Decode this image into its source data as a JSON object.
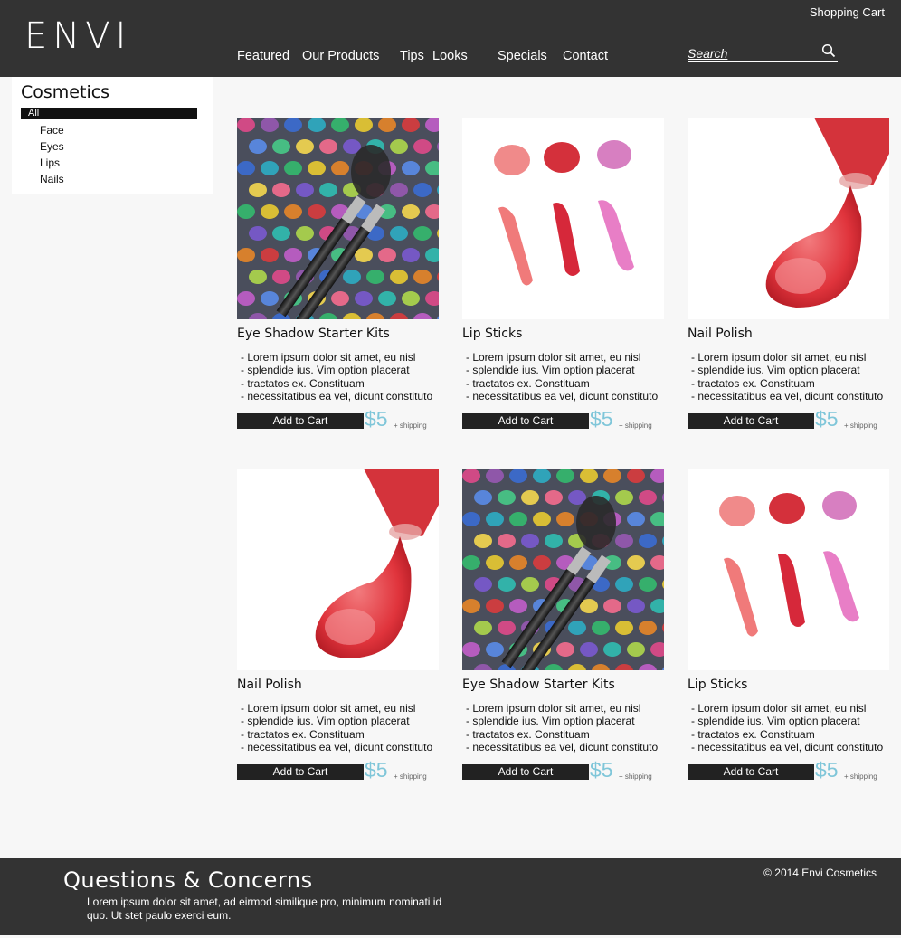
{
  "header": {
    "logo": "ENVI",
    "cart": "Shopping Cart",
    "nav": [
      "Featured",
      "Our Products",
      "Tips",
      "Looks",
      "Specials",
      "Contact"
    ],
    "search_placeholder": "Search"
  },
  "sidebar": {
    "title": "Cosmetics",
    "categories": [
      "All",
      "Face",
      "Eyes",
      "Lips",
      "Nails"
    ]
  },
  "products": [
    {
      "title": "Eye Shadow Starter Kits",
      "image": "eyeshadow-palette",
      "price": "$5",
      "shipping": "+ shipping",
      "button": "Add to Cart",
      "desc": [
        "- Lorem ipsum dolor sit amet, eu nisl",
        "- splendide ius. Vim option placerat",
        "- tractatos ex. Constituam",
        "- necessitatibus ea vel, dicunt constituto"
      ]
    },
    {
      "title": "Lip Sticks",
      "image": "lipstick-swatches",
      "price": "$5",
      "shipping": "+ shipping",
      "button": "Add to Cart",
      "desc": [
        "- Lorem ipsum dolor sit amet, eu nisl",
        "- splendide ius. Vim option placerat",
        "- tractatos ex. Constituam",
        "- necessitatibus ea vel, dicunt constituto"
      ]
    },
    {
      "title": "Nail Polish",
      "image": "nail-polish-spill",
      "price": "$5",
      "shipping": "+ shipping",
      "button": "Add to Cart",
      "desc": [
        "- Lorem ipsum dolor sit amet, eu nisl",
        "- splendide ius. Vim option placerat",
        "- tractatos ex. Constituam",
        "- necessitatibus ea vel, dicunt constituto"
      ]
    },
    {
      "title": "Nail Polish",
      "image": "nail-polish-spill",
      "price": "$5",
      "shipping": "+ shipping",
      "button": "Add to Cart",
      "desc": [
        "- Lorem ipsum dolor sit amet, eu nisl",
        "- splendide ius. Vim option placerat",
        "- tractatos ex. Constituam",
        "- necessitatibus ea vel, dicunt constituto"
      ]
    },
    {
      "title": "Eye Shadow Starter Kits",
      "image": "eyeshadow-palette",
      "price": "$5",
      "shipping": "+ shipping",
      "button": "Add to Cart",
      "desc": [
        "- Lorem ipsum dolor sit amet, eu nisl",
        "- splendide ius. Vim option placerat",
        "- tractatos ex. Constituam",
        "- necessitatibus ea vel, dicunt constituto"
      ]
    },
    {
      "title": "Lip Sticks",
      "image": "lipstick-swatches",
      "price": "$5",
      "shipping": "+ shipping",
      "button": "Add to Cart",
      "desc": [
        "- Lorem ipsum dolor sit amet, eu nisl",
        "- splendide ius. Vim option placerat",
        "- tractatos ex. Constituam",
        "- necessitatibus ea vel, dicunt constituto"
      ]
    }
  ],
  "footer": {
    "title": "Questions & Concerns",
    "text": "Lorem ipsum dolor sit amet, ad eirmod similique pro, minimum nominati id quo. Ut stet paulo exerci eum.",
    "copyright": "© 2014 Envi Cosmetics"
  },
  "colors": {
    "header_bg": "#333333",
    "accent_price": "#7fc6d9",
    "button_bg": "#222222"
  }
}
